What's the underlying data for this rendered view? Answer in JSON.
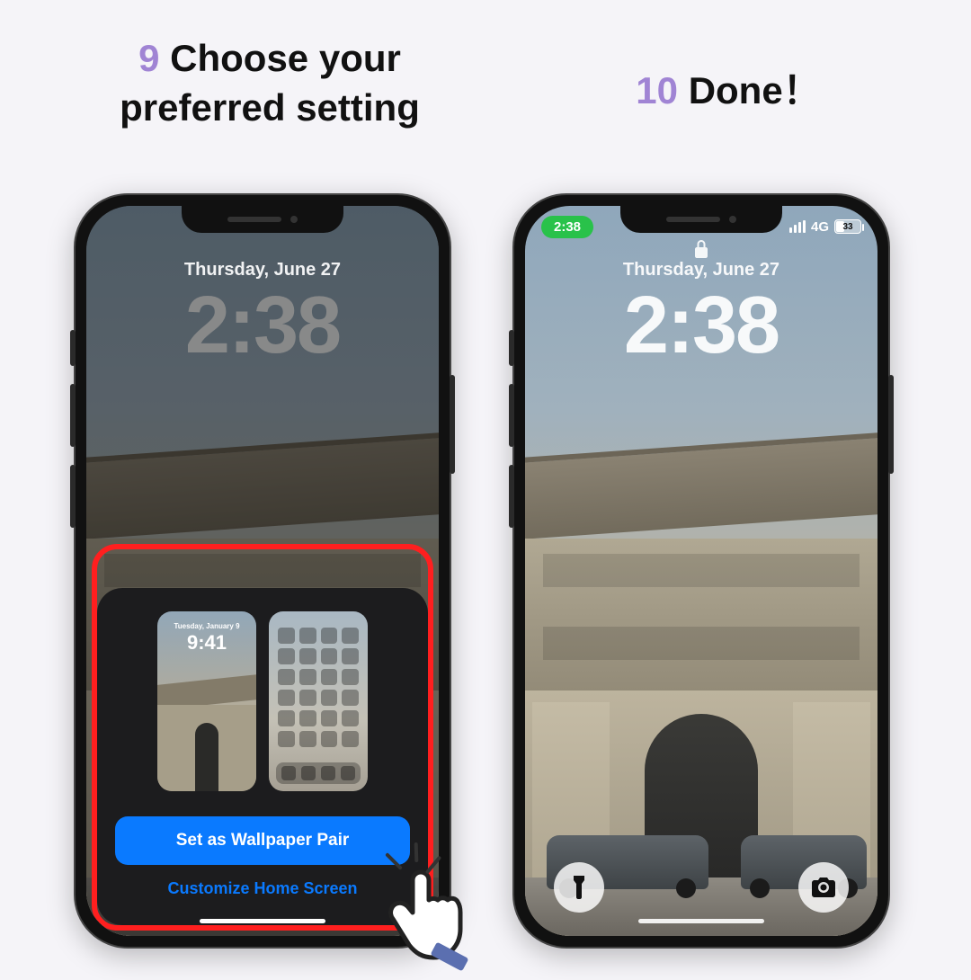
{
  "steps": {
    "s9": {
      "num": "9",
      "text_line1": "Choose your",
      "text_line2": "preferred setting"
    },
    "s10": {
      "num": "10",
      "text": "Done！"
    }
  },
  "lockscreen": {
    "date": "Thursday, June 27",
    "time": "2:38"
  },
  "status_bar": {
    "time": "2:38",
    "network": "4G",
    "battery_pct": "33"
  },
  "wallpaper_sheet": {
    "preview_lock": {
      "date": "Tuesday, January 9",
      "time": "9:41"
    },
    "set_pair_btn": "Set as Wallpaper Pair",
    "customize_link": "Customize Home Screen"
  },
  "icons": {
    "lock": "lock",
    "flashlight": "flashlight",
    "camera": "camera"
  },
  "colors": {
    "accent_purple": "#a084d4",
    "ios_blue": "#0a7aff",
    "highlight_red": "#ff1f1f",
    "status_green": "#29c24a"
  }
}
